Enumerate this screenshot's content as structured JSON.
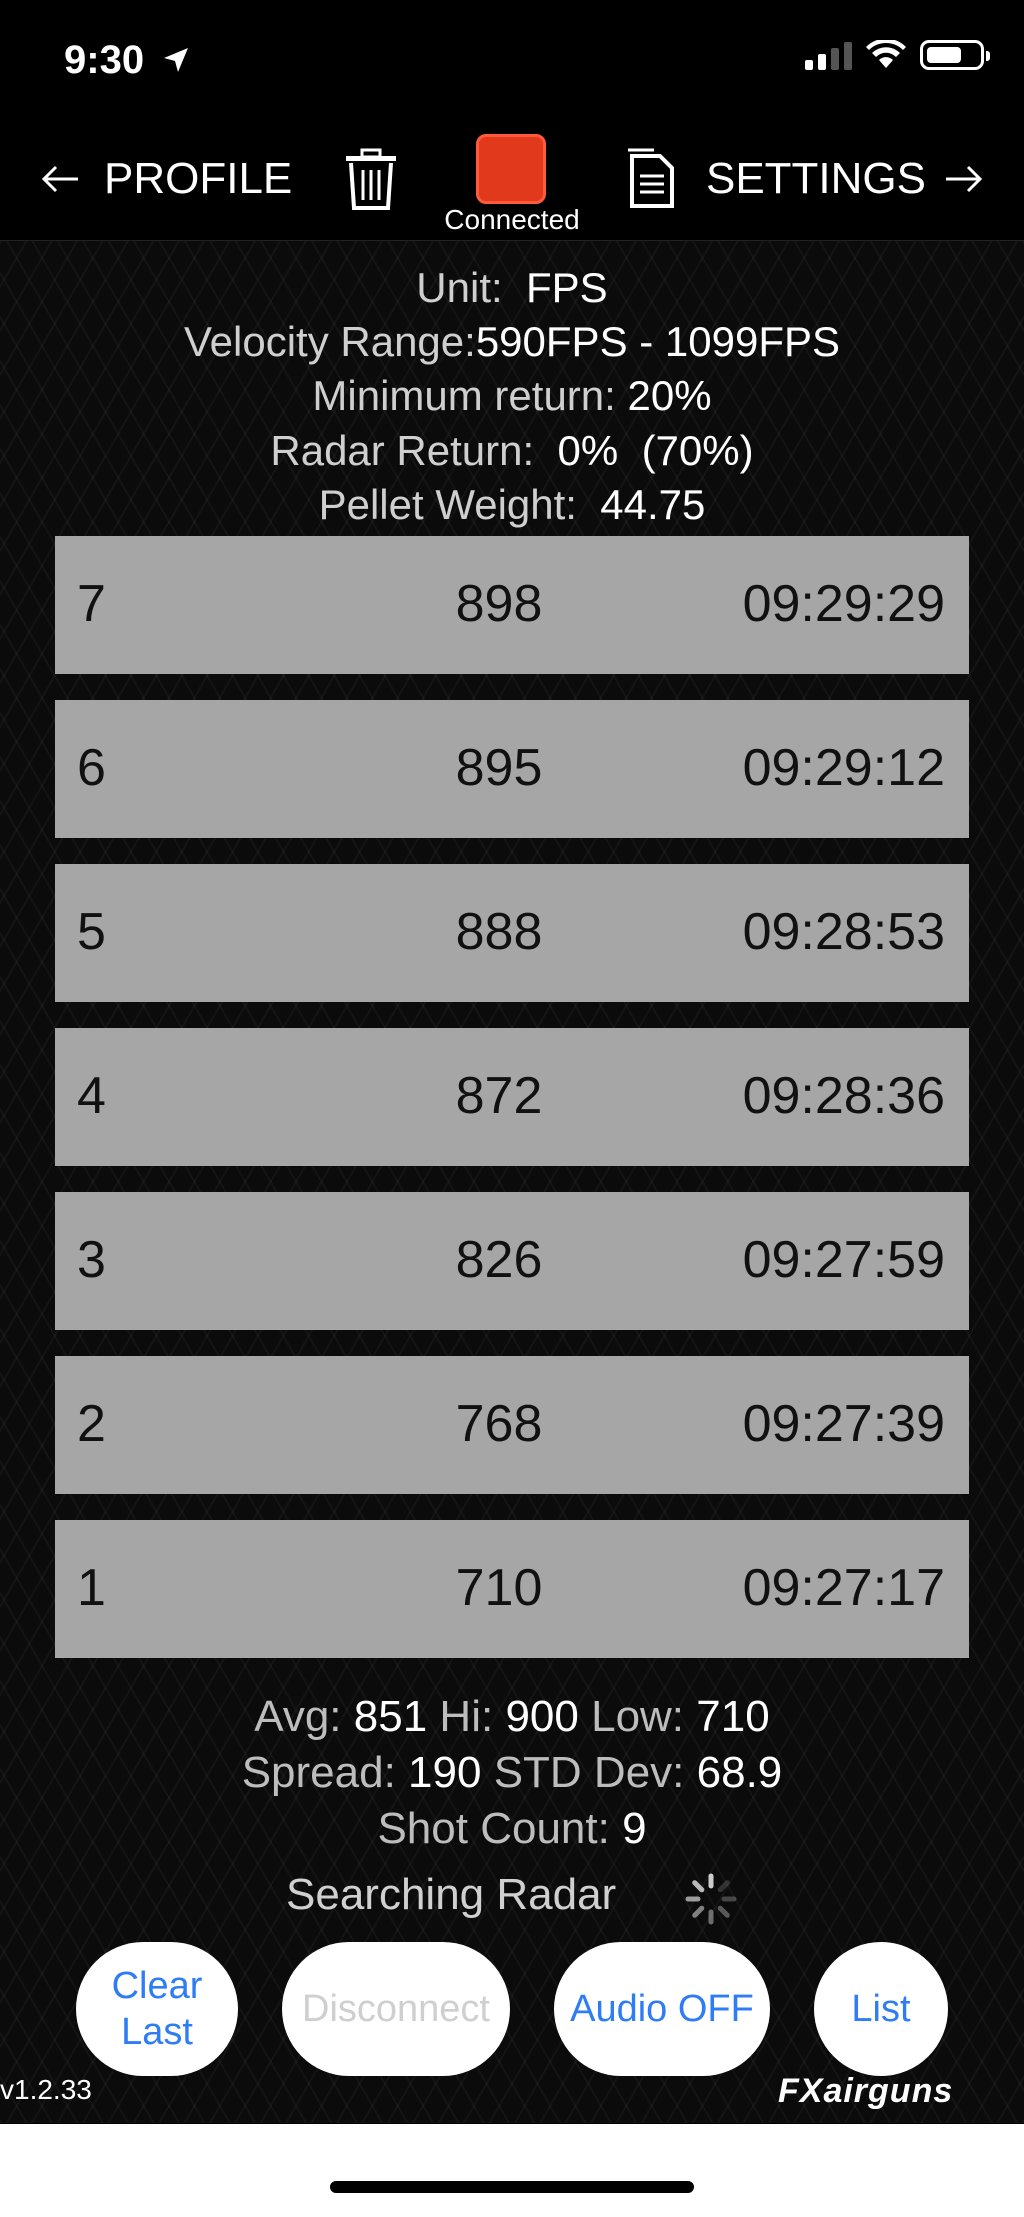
{
  "status_bar": {
    "time": "9:30"
  },
  "nav": {
    "back_label": "PROFILE",
    "settings_label": "SETTINGS",
    "device_status": "Connected",
    "device_color": "#e0391c"
  },
  "info": {
    "unit_label": "Unit:",
    "unit_value": "FPS",
    "velocity_label": "Velocity Range:",
    "velocity_value": "590FPS - 1099FPS",
    "min_return_label": "Minimum return:",
    "min_return_value": "20%",
    "radar_label": "Radar Return:",
    "radar_value": "0%",
    "radar_secondary": "(70%)",
    "pellet_label": "Pellet Weight:",
    "pellet_value": "44.75"
  },
  "shots": [
    {
      "number": "7",
      "velocity": "898",
      "time": "09:29:29"
    },
    {
      "number": "6",
      "velocity": "895",
      "time": "09:29:12"
    },
    {
      "number": "5",
      "velocity": "888",
      "time": "09:28:53"
    },
    {
      "number": "4",
      "velocity": "872",
      "time": "09:28:36"
    },
    {
      "number": "3",
      "velocity": "826",
      "time": "09:27:59"
    },
    {
      "number": "2",
      "velocity": "768",
      "time": "09:27:39"
    },
    {
      "number": "1",
      "velocity": "710",
      "time": "09:27:17"
    }
  ],
  "stats": {
    "avg_label": "Avg:",
    "avg_value": "851",
    "hi_label": "Hi:",
    "hi_value": "900",
    "low_label": "Low:",
    "low_value": "710",
    "spread_label": "Spread:",
    "spread_value": "190",
    "std_label": "STD Dev:",
    "std_value": "68.9",
    "count_label": "Shot Count:",
    "count_value": "9"
  },
  "status_text": "Searching Radar",
  "buttons": {
    "clear_line1": "Clear",
    "clear_line2": "Last",
    "disconnect": "Disconnect",
    "audio": "Audio OFF",
    "list": "List"
  },
  "version": "v1.2.33",
  "brand": "FXairguns",
  "colors": {
    "accent": "#2e7cf6",
    "row_bg": "#a6a6a6"
  }
}
